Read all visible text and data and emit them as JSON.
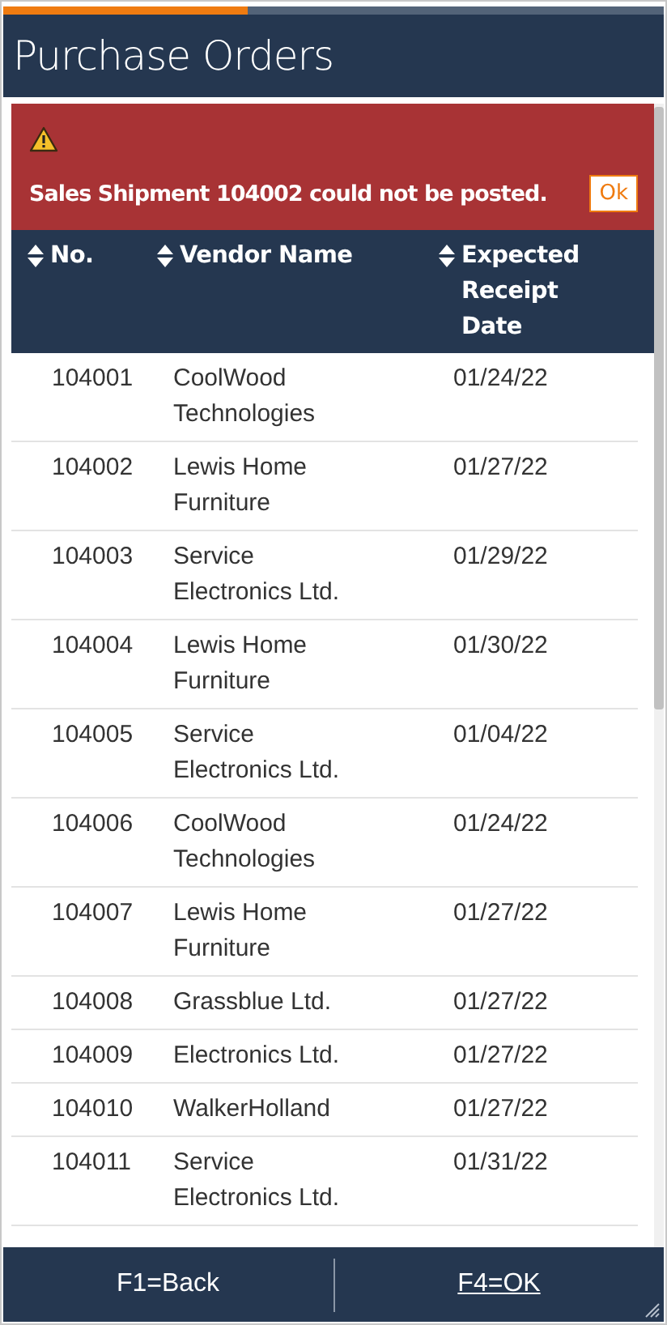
{
  "progress": {
    "level": 0.37
  },
  "window": {
    "title": "Purchase Orders"
  },
  "alert": {
    "message": "Sales Shipment 104002 could not be posted.",
    "button": "Ok"
  },
  "table": {
    "columns": [
      "No.",
      "Vendor Name",
      "Expected Receipt Date"
    ],
    "rows": [
      {
        "no": "104001",
        "vendor": "CoolWood Technologies",
        "date": "01/24/22"
      },
      {
        "no": "104002",
        "vendor": "Lewis Home Furniture",
        "date": "01/27/22"
      },
      {
        "no": "104003",
        "vendor": "Service Electronics Ltd.",
        "date": "01/29/22"
      },
      {
        "no": "104004",
        "vendor": "Lewis Home Furniture",
        "date": "01/30/22"
      },
      {
        "no": "104005",
        "vendor": "Service Electronics Ltd.",
        "date": "01/04/22"
      },
      {
        "no": "104006",
        "vendor": "CoolWood Technologies",
        "date": "01/24/22"
      },
      {
        "no": "104007",
        "vendor": "Lewis Home Furniture",
        "date": "01/27/22"
      },
      {
        "no": "104008",
        "vendor": "Grassblue Ltd.",
        "date": "01/27/22"
      },
      {
        "no": "104009",
        "vendor": "Electronics Ltd.",
        "date": "01/27/22"
      },
      {
        "no": "104010",
        "vendor": "WalkerHolland",
        "date": "01/27/22"
      },
      {
        "no": "104011",
        "vendor": "Service Electronics Ltd.",
        "date": "01/31/22"
      }
    ]
  },
  "footer": [
    {
      "label": "F1=Back",
      "default": false
    },
    {
      "label": "F4=OK",
      "default": true
    }
  ]
}
